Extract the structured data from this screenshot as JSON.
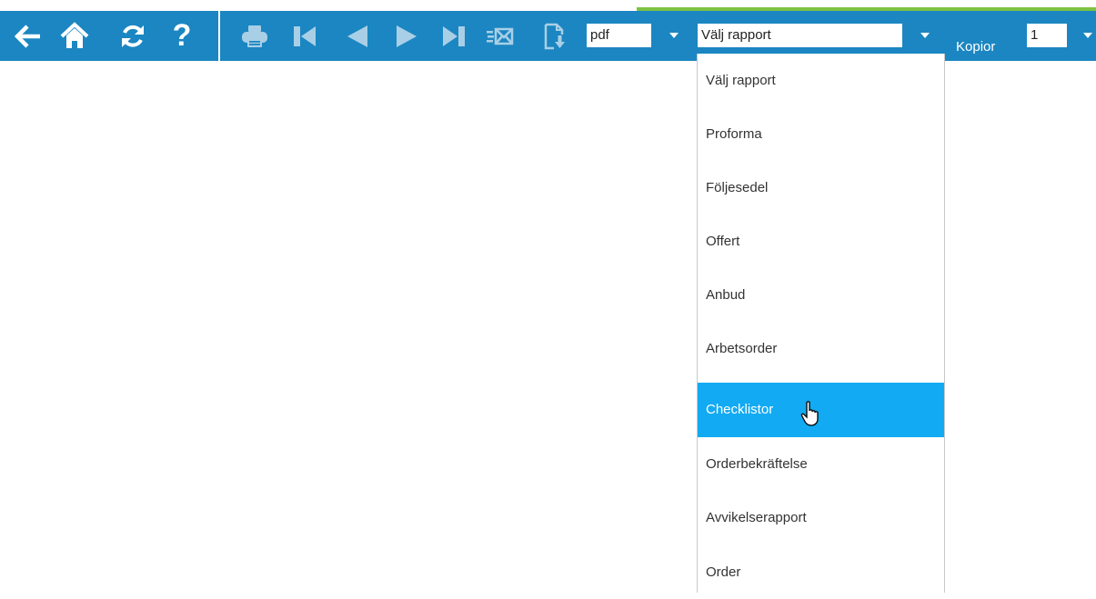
{
  "colors": {
    "toolbar_bg": "#1b86c2",
    "highlight": "#12aaf2",
    "accent_strip": "#7dc242"
  },
  "toolbar": {
    "buttons": [
      {
        "name": "back-arrow-icon"
      },
      {
        "name": "home-icon"
      },
      {
        "name": "refresh-icon"
      },
      {
        "name": "help-icon",
        "glyph": "?"
      },
      {
        "name": "print-icon"
      },
      {
        "name": "first-page-icon"
      },
      {
        "name": "previous-page-icon"
      },
      {
        "name": "next-page-icon"
      },
      {
        "name": "last-page-icon"
      },
      {
        "name": "send-email-icon"
      },
      {
        "name": "export-icon"
      }
    ],
    "format_select": {
      "value": "pdf"
    },
    "report_select": {
      "value": "Välj rapport"
    },
    "copies": {
      "label": "Kopior",
      "value": "1"
    }
  },
  "report_dropdown": {
    "options": [
      "Välj rapport",
      "Proforma",
      "Följesedel",
      "Offert",
      "Anbud",
      "Arbetsorder",
      "Checklistor",
      "Orderbekräftelse",
      "Avvikelserapport",
      "Order"
    ],
    "highlighted": "Checklistor"
  }
}
